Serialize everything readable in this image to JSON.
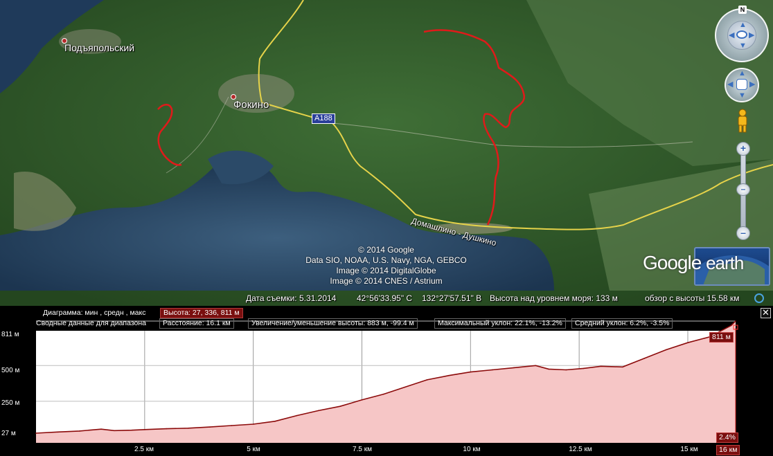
{
  "map": {
    "places": [
      {
        "name": "Подъяпольский"
      },
      {
        "name": "Фокино"
      }
    ],
    "road_badge": "A188",
    "road_label": "Домашлино - Душкино",
    "attribution": [
      "© 2014 Google",
      "Data SIO, NOAA, U.S. Navy, NGA, GEBCO",
      "Image © 2014 DigitalGlobe",
      "Image © 2014 CNES / Astrium"
    ],
    "logo": {
      "google": "Google",
      "earth": "earth"
    },
    "north": "N"
  },
  "status_bar": {
    "capture_date": "Дата съемки: 5.31.2014",
    "lat": "42°56'33.95\" С",
    "lon": "132°27'57.51\" В",
    "elevation": "Высота над уровнем моря:   133 м",
    "eye_alt": "обзор с высоты  15.58 км"
  },
  "elevation_panel": {
    "row1_label": "Диаграмма: мин , средн , макс",
    "row1_value": "Высота: 27, 336, 811 м",
    "row2_label": "Сводные данные для диапазона",
    "row2_items": [
      "Расстояние: 16.1 км",
      "Увеличение/уменьшение высоты: 883 м, -99.4 м",
      "Максимальный уклон: 22.1%, -13.2%",
      "Средний уклон: 6.2%, -3.5%"
    ],
    "close": "✕",
    "cursor_elev": "811 м",
    "cursor_slope": "2.4%",
    "cursor_dist": "16 км"
  },
  "chart_data": {
    "type": "area",
    "y_ticks": [
      "811 м",
      "500 м",
      "250 м",
      "27 м"
    ],
    "x_ticks": [
      "2.5 км",
      "5 км",
      "7.5 км",
      "10 км",
      "12.5 км",
      "15 км"
    ],
    "xlim": [
      0,
      16.1
    ],
    "ylim": [
      27,
      811
    ],
    "x": [
      0,
      0.5,
      1,
      1.5,
      1.8,
      2.2,
      2.5,
      3,
      3.5,
      4,
      4.5,
      5,
      5.5,
      6,
      6.5,
      7,
      7.5,
      8,
      8.5,
      9,
      9.5,
      10,
      10.5,
      11,
      11.5,
      11.8,
      12.2,
      12.6,
      13,
      13.5,
      14,
      14.5,
      15,
      15.5,
      16,
      16.1
    ],
    "y": [
      27,
      35,
      42,
      55,
      45,
      48,
      52,
      58,
      62,
      70,
      80,
      90,
      110,
      150,
      185,
      215,
      260,
      300,
      350,
      400,
      430,
      455,
      470,
      485,
      500,
      475,
      470,
      480,
      495,
      490,
      550,
      610,
      660,
      700,
      780,
      811
    ]
  }
}
